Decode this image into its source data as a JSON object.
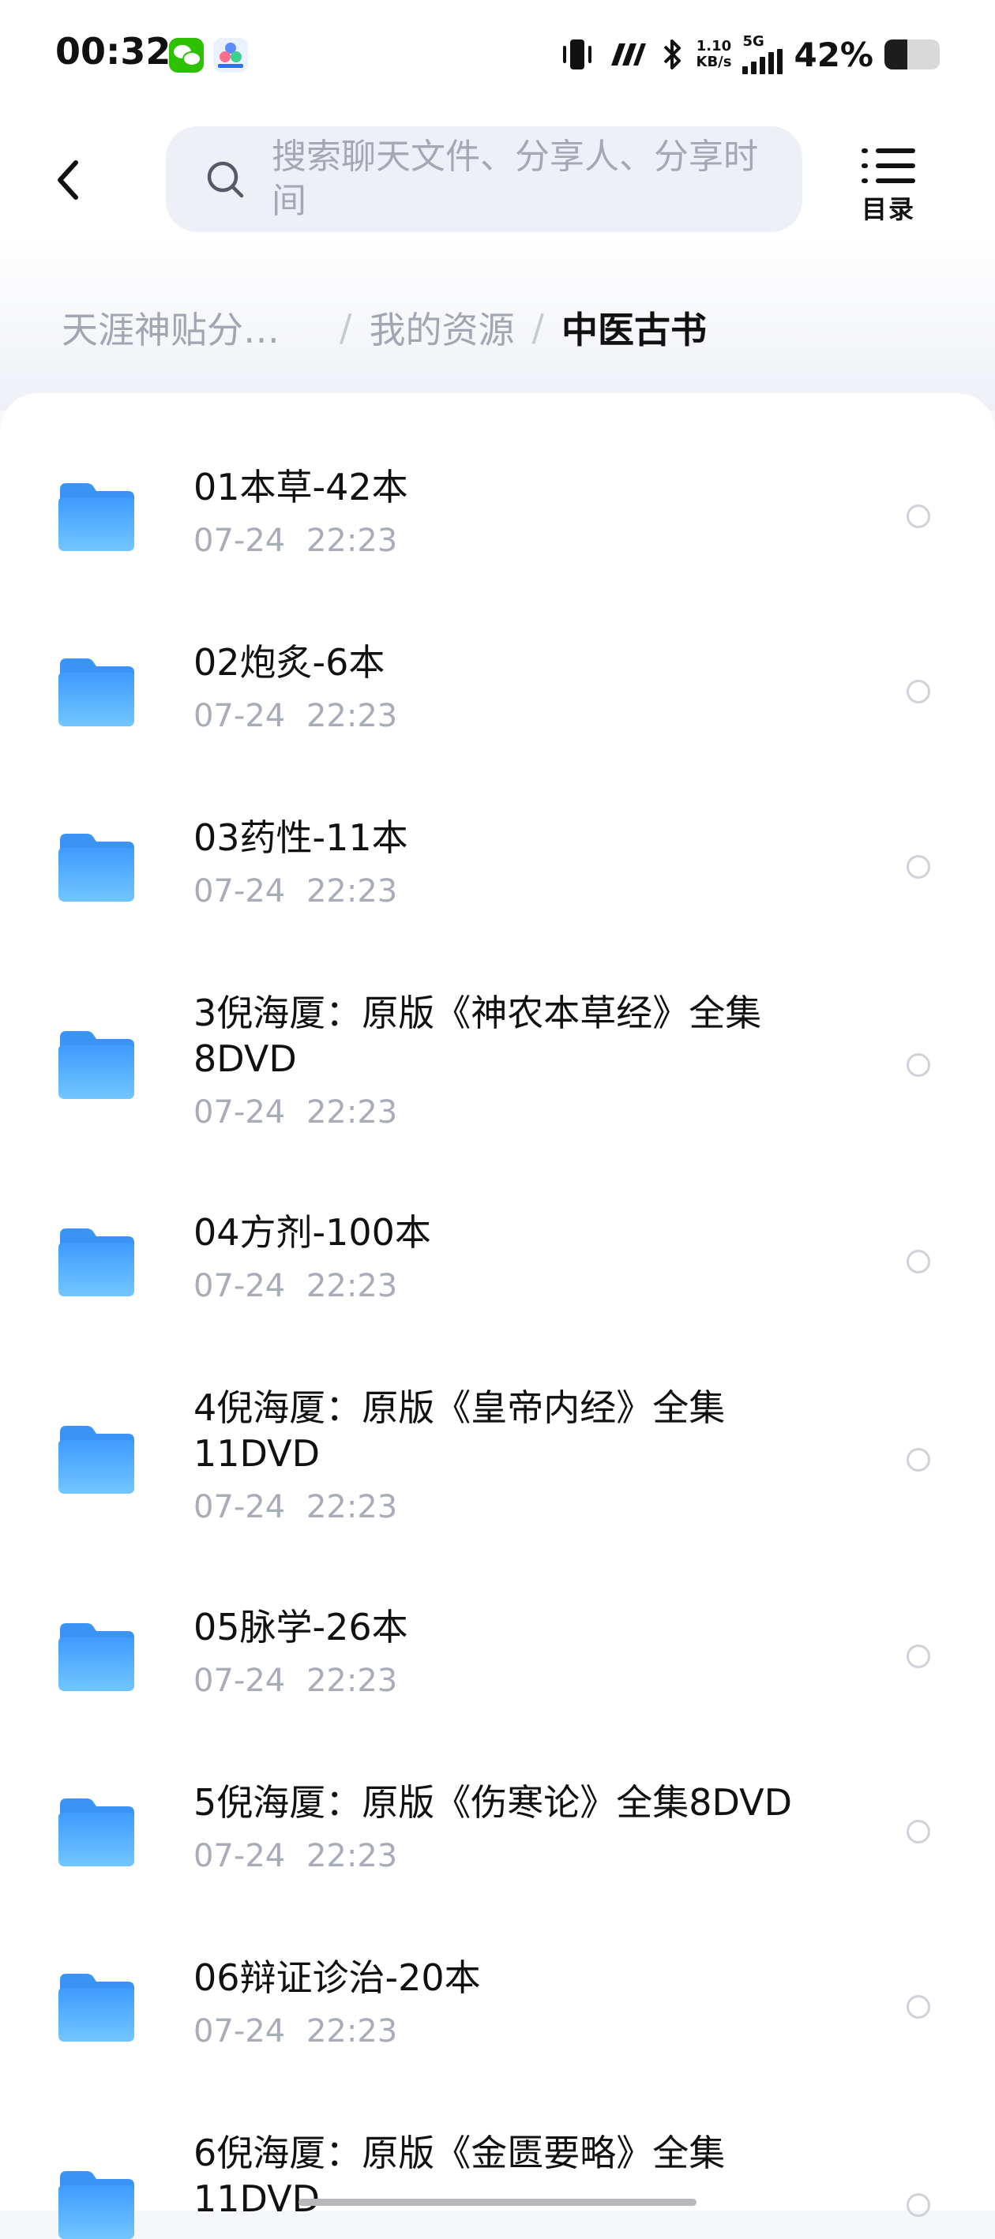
{
  "status_bar": {
    "time": "00:32",
    "net_speed_value": "1.10",
    "net_speed_unit": "KB/s",
    "network_type": "5G",
    "battery_pct": "42%",
    "battery_level": 0.42,
    "icons": [
      "wechat-icon",
      "baidu-netdisk-icon",
      "vibrate-icon",
      "nfc-icon",
      "bluetooth-icon",
      "signal-icon",
      "battery-icon"
    ]
  },
  "header": {
    "search_placeholder": "搜索聊天文件、分享人、分享时间",
    "toc_label": "目录"
  },
  "breadcrumb": {
    "items": [
      "天涯神贴分…",
      "我的资源",
      "中医古书"
    ],
    "separator": "/"
  },
  "files": [
    {
      "name": "01本草-42本",
      "date": "07-24 22:23"
    },
    {
      "name": "02炮炙-6本",
      "date": "07-24 22:23"
    },
    {
      "name": "03药性-11本",
      "date": "07-24 22:23"
    },
    {
      "name": "3倪海厦：原版《神农本草经》全集8DVD",
      "date": "07-24 22:23"
    },
    {
      "name": "04方剂-100本",
      "date": "07-24 22:23"
    },
    {
      "name": "4倪海厦：原版《皇帝内经》全集11DVD",
      "date": "07-24 22:23"
    },
    {
      "name": "05脉学-26本",
      "date": "07-24 22:23"
    },
    {
      "name": "5倪海厦：原版《伤寒论》全集8DVD",
      "date": "07-24 22:23"
    },
    {
      "name": "06辩证诊治-20本",
      "date": "07-24 22:23"
    },
    {
      "name": "6倪海厦：原版《金匮要略》全集11DVD",
      "date": ""
    }
  ],
  "colors": {
    "folder_top": "#4aa3ff",
    "folder_bottom": "#6ec3ff",
    "muted_text": "#a7acb8",
    "search_bg": "#eef0f7"
  }
}
